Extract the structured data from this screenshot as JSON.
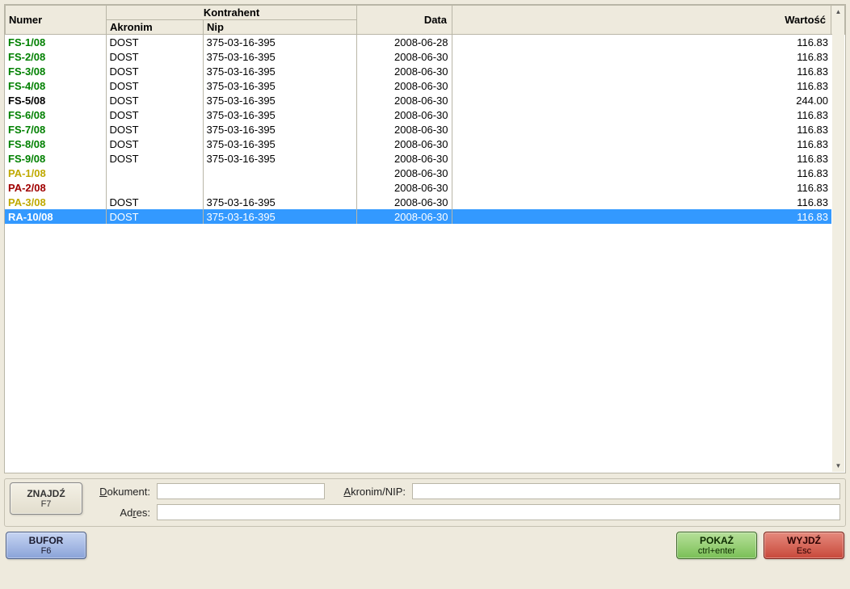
{
  "grid": {
    "headers": {
      "numer": "Numer",
      "kontrahent": "Kontrahent",
      "akronim": "Akronim",
      "nip": "Nip",
      "data": "Data",
      "wartosc": "Wartość"
    },
    "rows": [
      {
        "numer": "FS-1/08",
        "akronim": "DOST",
        "nip": "375-03-16-395",
        "data": "2008-06-28",
        "wartosc": "116.83",
        "cls": "green",
        "sel": false
      },
      {
        "numer": "FS-2/08",
        "akronim": "DOST",
        "nip": "375-03-16-395",
        "data": "2008-06-30",
        "wartosc": "116.83",
        "cls": "green",
        "sel": false
      },
      {
        "numer": "FS-3/08",
        "akronim": "DOST",
        "nip": "375-03-16-395",
        "data": "2008-06-30",
        "wartosc": "116.83",
        "cls": "green",
        "sel": false
      },
      {
        "numer": "FS-4/08",
        "akronim": "DOST",
        "nip": "375-03-16-395",
        "data": "2008-06-30",
        "wartosc": "116.83",
        "cls": "green",
        "sel": false
      },
      {
        "numer": "FS-5/08",
        "akronim": "DOST",
        "nip": "375-03-16-395",
        "data": "2008-06-30",
        "wartosc": "244.00",
        "cls": "black",
        "sel": false
      },
      {
        "numer": "FS-6/08",
        "akronim": "DOST",
        "nip": "375-03-16-395",
        "data": "2008-06-30",
        "wartosc": "116.83",
        "cls": "green",
        "sel": false
      },
      {
        "numer": "FS-7/08",
        "akronim": "DOST",
        "nip": "375-03-16-395",
        "data": "2008-06-30",
        "wartosc": "116.83",
        "cls": "green",
        "sel": false
      },
      {
        "numer": "FS-8/08",
        "akronim": "DOST",
        "nip": "375-03-16-395",
        "data": "2008-06-30",
        "wartosc": "116.83",
        "cls": "green",
        "sel": false
      },
      {
        "numer": "FS-9/08",
        "akronim": "DOST",
        "nip": "375-03-16-395",
        "data": "2008-06-30",
        "wartosc": "116.83",
        "cls": "green",
        "sel": false
      },
      {
        "numer": "PA-1/08",
        "akronim": "",
        "nip": "",
        "data": "2008-06-30",
        "wartosc": "116.83",
        "cls": "yellow",
        "sel": false
      },
      {
        "numer": "PA-2/08",
        "akronim": "",
        "nip": "",
        "data": "2008-06-30",
        "wartosc": "116.83",
        "cls": "red",
        "sel": false
      },
      {
        "numer": "PA-3/08",
        "akronim": "DOST",
        "nip": "375-03-16-395",
        "data": "2008-06-30",
        "wartosc": "116.83",
        "cls": "yellow",
        "sel": false
      },
      {
        "numer": "RA-10/08",
        "akronim": "DOST",
        "nip": "375-03-16-395",
        "data": "2008-06-30",
        "wartosc": "116.83",
        "cls": "blue",
        "sel": true
      }
    ]
  },
  "search": {
    "dokument_label": "Dokument:",
    "dokument_label_ul": "D",
    "akronim_label": "Akronim/NIP:",
    "akronim_label_ul": "A",
    "adres_label": "Adres:",
    "adres_label_ul": "r",
    "dokument_value": "",
    "akronim_value": "",
    "adres_value": ""
  },
  "buttons": {
    "find_l1": "ZNAJDŹ",
    "find_l2": "F7",
    "bufor_l1": "BUFOR",
    "bufor_l2": "F6",
    "pokaz_l1": "POKAŻ",
    "pokaz_l2": "ctrl+enter",
    "wyjdz_l1": "WYJDŹ",
    "wyjdz_l2": "Esc"
  }
}
